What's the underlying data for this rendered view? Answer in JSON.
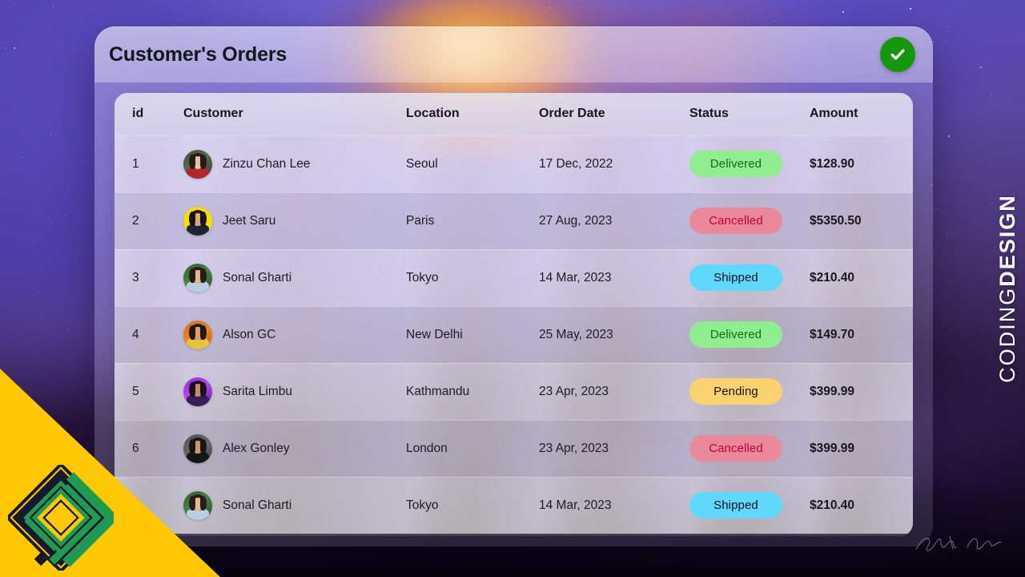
{
  "window": {
    "title": "Customer's Orders",
    "status_icon": "check-circle-icon",
    "status_color": "#16960f"
  },
  "brand": {
    "light_part": "CODING",
    "bold_part": "DESIGN",
    "logo_icon": "codingdesign-diamond-d-logo",
    "logo_colors": {
      "yellow": "#FFC800",
      "green": "#1E9B52",
      "navy": "#15192B"
    }
  },
  "table": {
    "columns": [
      "id",
      "Customer",
      "Location",
      "Order Date",
      "Status",
      "Amount"
    ],
    "status_styles": {
      "Delivered": {
        "bg": "#90EE90",
        "fg": "#0d6b17"
      },
      "Cancelled": {
        "bg": "#E9899B",
        "fg": "#c40028"
      },
      "Shipped": {
        "bg": "#5FD8FB",
        "fg": "#111318"
      },
      "Pending": {
        "bg": "#FCD170",
        "fg": "#111318"
      }
    },
    "rows": [
      {
        "id": "1",
        "customer": "Zinzu Chan Lee",
        "location": "Seoul",
        "date": "17 Dec, 2022",
        "status": "Delivered",
        "amount": "$128.90",
        "avatar": "avatar-zinzu-chan-lee"
      },
      {
        "id": "2",
        "customer": "Jeet Saru",
        "location": "Paris",
        "date": "27 Aug, 2023",
        "status": "Cancelled",
        "amount": "$5350.50",
        "avatar": "avatar-jeet-saru"
      },
      {
        "id": "3",
        "customer": "Sonal Gharti",
        "location": "Tokyo",
        "date": "14 Mar, 2023",
        "status": "Shipped",
        "amount": "$210.40",
        "avatar": "avatar-sonal-gharti"
      },
      {
        "id": "4",
        "customer": "Alson GC",
        "location": "New Delhi",
        "date": "25 May, 2023",
        "status": "Delivered",
        "amount": "$149.70",
        "avatar": "avatar-alson-gc"
      },
      {
        "id": "5",
        "customer": "Sarita Limbu",
        "location": "Kathmandu",
        "date": "23 Apr, 2023",
        "status": "Pending",
        "amount": "$399.99",
        "avatar": "avatar-sarita-limbu"
      },
      {
        "id": "6",
        "customer": "Alex Gonley",
        "location": "London",
        "date": "23 Apr, 2023",
        "status": "Cancelled",
        "amount": "$399.99",
        "avatar": "avatar-alex-gonley"
      },
      {
        "id": "",
        "customer": "Sonal Gharti",
        "location": "Tokyo",
        "date": "14 Mar, 2023",
        "status": "Shipped",
        "amount": "$210.40",
        "avatar": "avatar-sonal-gharti"
      }
    ]
  }
}
